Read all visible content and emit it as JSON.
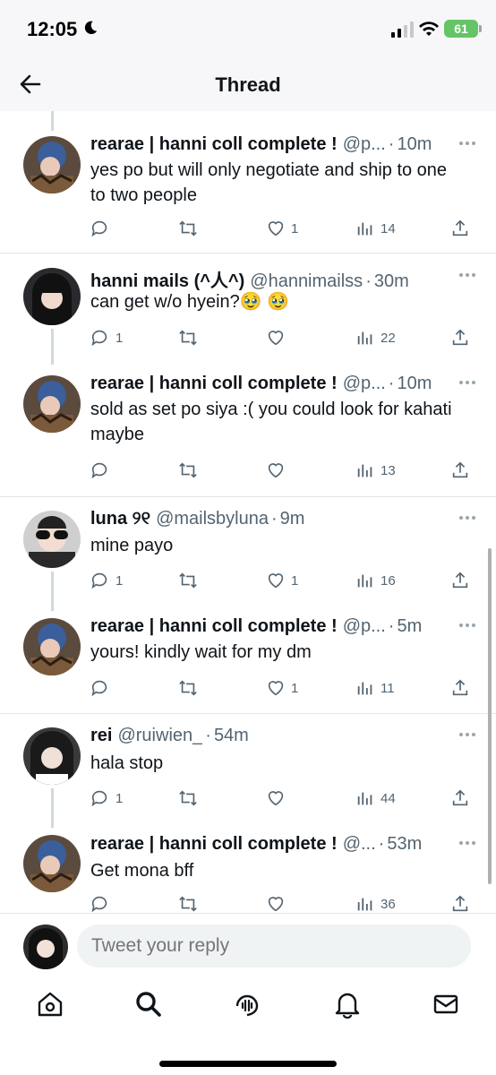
{
  "status_bar": {
    "time": "12:05",
    "battery": "61"
  },
  "header": {
    "title": "Thread"
  },
  "tweets": [
    {
      "name": "rearae | hanni coll complete !",
      "handle": "@p...",
      "time": "10m",
      "text": "yes po but will only negotiate and ship to one to two people",
      "replies": "",
      "likes": "1",
      "views": "14"
    },
    {
      "name": "hanni mails (^人^)",
      "handle": "@hannimailss",
      "time": "30m",
      "text": "can get w/o hyein?🥹 🥹",
      "replies": "1",
      "likes": "",
      "views": "22"
    },
    {
      "name": "rearae | hanni coll complete !",
      "handle": "@p...",
      "time": "10m",
      "text": "sold as set po siya :( you could look for kahati maybe",
      "replies": "",
      "likes": "",
      "views": "13"
    },
    {
      "name": "luna ୨୧",
      "handle": "@mailsbyluna",
      "time": "9m",
      "text": "mine payo",
      "replies": "1",
      "likes": "1",
      "views": "16"
    },
    {
      "name": "rearae | hanni coll complete !",
      "handle": "@p...",
      "time": "5m",
      "text": "yours! kindly wait for my dm",
      "replies": "",
      "likes": "1",
      "views": "11"
    },
    {
      "name": "rei",
      "handle": "@ruiwien_",
      "time": "54m",
      "text": "hala stop",
      "replies": "1",
      "likes": "",
      "views": "44"
    },
    {
      "name": "rearae | hanni coll complete !",
      "handle": "@...",
      "time": "53m",
      "text": "Get mona bff",
      "replies": "",
      "likes": "",
      "views": "36"
    }
  ],
  "reply_bar": {
    "placeholder": "Tweet your reply"
  },
  "bottom_nav": [
    "home-icon",
    "search-icon",
    "spaces-icon",
    "notifications-icon",
    "messages-icon"
  ]
}
